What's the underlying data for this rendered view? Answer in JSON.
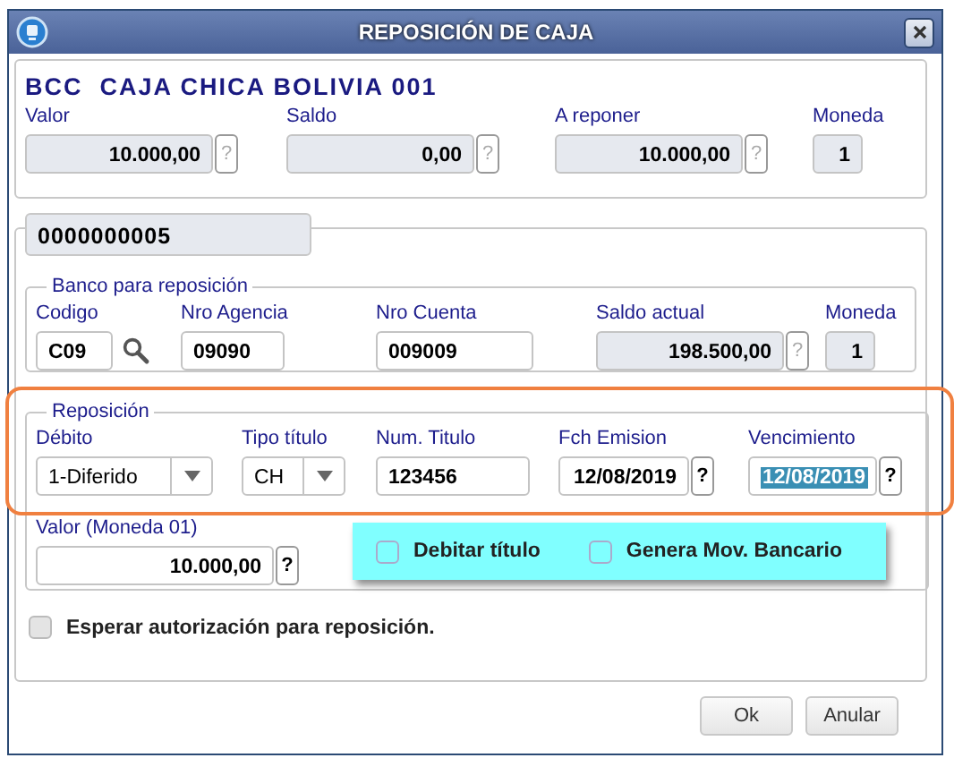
{
  "window": {
    "title": "REPOSICIÓN DE CAJA"
  },
  "caja": {
    "title": "BCC  CAJA CHICA BOLIVIA 001",
    "fields": [
      {
        "label": "Valor",
        "value": "10.000,00",
        "help": "?",
        "kind": "amount",
        "readonly": true
      },
      {
        "label": "Saldo",
        "value": "0,00",
        "help": "?",
        "kind": "amount",
        "readonly": true
      },
      {
        "label": "A reponer",
        "value": "10.000,00",
        "help": "?",
        "kind": "amount",
        "readonly": true
      },
      {
        "label": "Moneda",
        "value": "1",
        "kind": "amount",
        "readonly": true
      }
    ]
  },
  "tab": {
    "label": "0000000005"
  },
  "banco": {
    "title": "Banco para reposición",
    "fields": [
      {
        "label": "Codigo",
        "value": "C09",
        "kind": "lookup",
        "readonly": false
      },
      {
        "label": "Nro Agencia",
        "value": "09090",
        "kind": "text",
        "readonly": false
      },
      {
        "label": "Nro Cuenta",
        "value": "009009",
        "kind": "text",
        "readonly": false
      },
      {
        "label": "Saldo actual",
        "value": "198.500,00",
        "help": "?",
        "kind": "amount",
        "readonly": true
      },
      {
        "label": "Moneda",
        "value": "1",
        "kind": "amount",
        "readonly": true
      }
    ]
  },
  "reposicion": {
    "title": "Reposición",
    "outlined": true,
    "fields": [
      {
        "label": "Débito",
        "value": "1-Diferido",
        "kind": "select",
        "readonly": false
      },
      {
        "label": "Tipo título",
        "value": "CH",
        "kind": "select",
        "readonly": false
      },
      {
        "label": "Num. Titulo",
        "value": "123456",
        "kind": "text",
        "readonly": false
      },
      {
        "label": "Fch Emision",
        "value": "12/08/2019",
        "help": "?",
        "kind": "amount",
        "readonly": false
      },
      {
        "label": "Vencimiento",
        "value": "12/08/2019",
        "help": "?",
        "kind": "amount",
        "readonly": false,
        "highlighted": true
      }
    ],
    "valor": {
      "label": "Valor (Moneda 01)",
      "value": "10.000,00",
      "help": "?"
    },
    "options": [
      {
        "label": "Debitar título",
        "checked": false
      },
      {
        "label": "Genera Mov. Bancario",
        "checked": false
      }
    ]
  },
  "esperar": {
    "label": "Esperar autorización para reposición.",
    "checked": false
  },
  "buttons": [
    "Ok",
    "Anular"
  ]
}
